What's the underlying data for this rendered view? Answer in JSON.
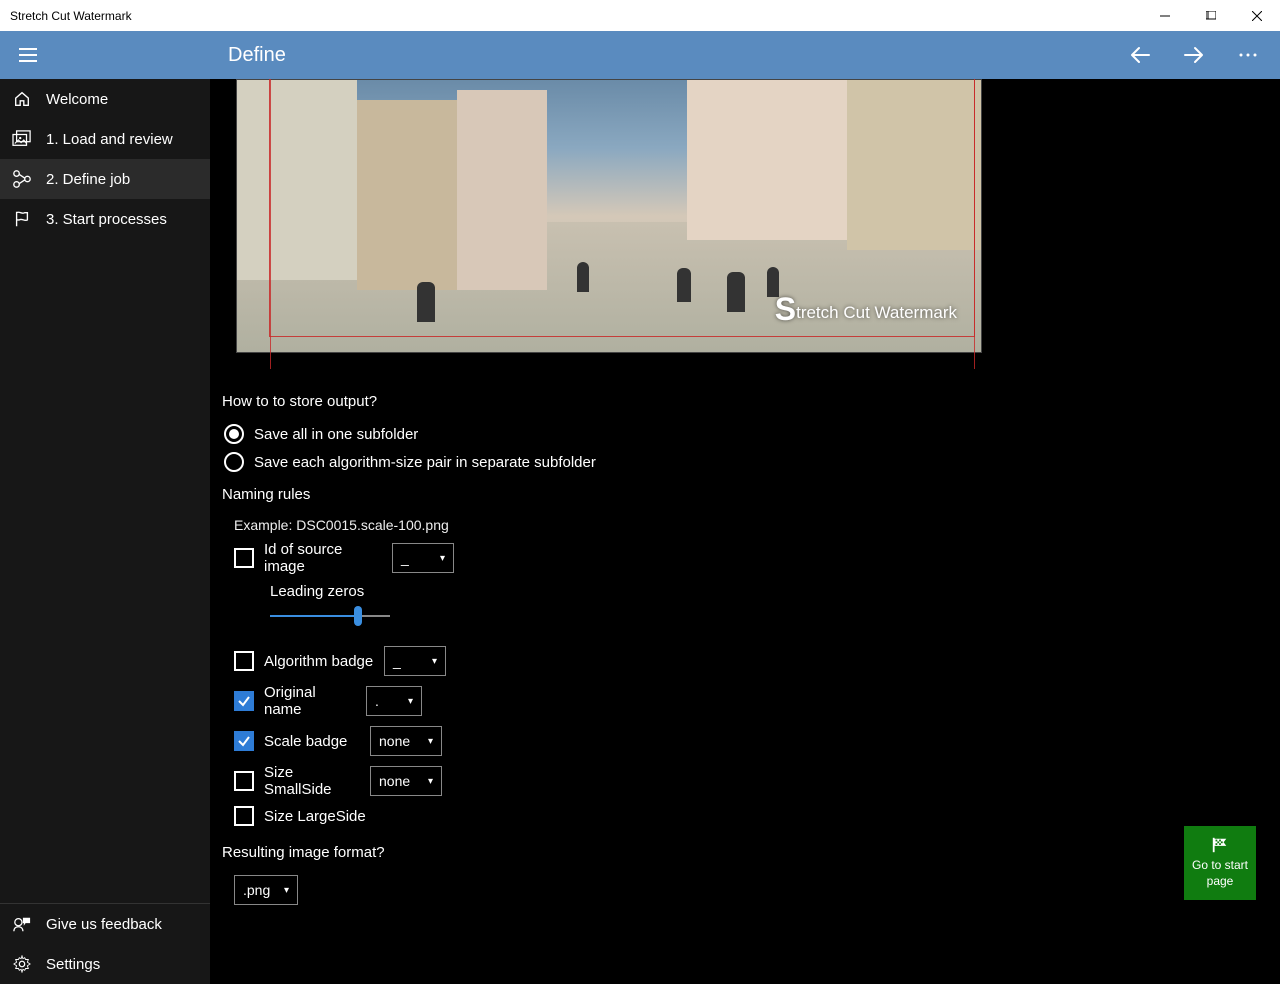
{
  "window": {
    "title": "Stretch Cut Watermark"
  },
  "header": {
    "title": "Define"
  },
  "sidebar": {
    "items": [
      {
        "label": "Welcome"
      },
      {
        "label": "1. Load and review"
      },
      {
        "label": "2. Define job"
      },
      {
        "label": "3. Start processes"
      }
    ],
    "feedback_label": "Give us feedback",
    "settings_label": "Settings"
  },
  "preview": {
    "watermark_prefix": "S",
    "watermark_text": "tretch Cut Watermark"
  },
  "form": {
    "store_label": "How to to store output?",
    "radio_one": "Save all in one subfolder",
    "radio_separate": "Save each algorithm-size pair in separate subfolder",
    "naming_label": "Naming rules",
    "example_label": "Example: DSC0015.scale-100.png",
    "rules": {
      "id_source": {
        "label": "Id of source image",
        "sep": "_"
      },
      "leading_zeros_label": "Leading zeros",
      "algorithm_badge": {
        "label": "Algorithm badge",
        "sep": "_"
      },
      "original_name": {
        "label": "Original name",
        "sep": "."
      },
      "scale_badge": {
        "label": "Scale badge",
        "sep": "none"
      },
      "size_small": {
        "label": "Size SmallSide",
        "sep": "none"
      },
      "size_large": {
        "label": "Size LargeSide"
      }
    },
    "result_format_label": "Resulting image format?",
    "result_format_value": ".png"
  },
  "go_start": {
    "line1": "Go to start",
    "line2": "page"
  }
}
